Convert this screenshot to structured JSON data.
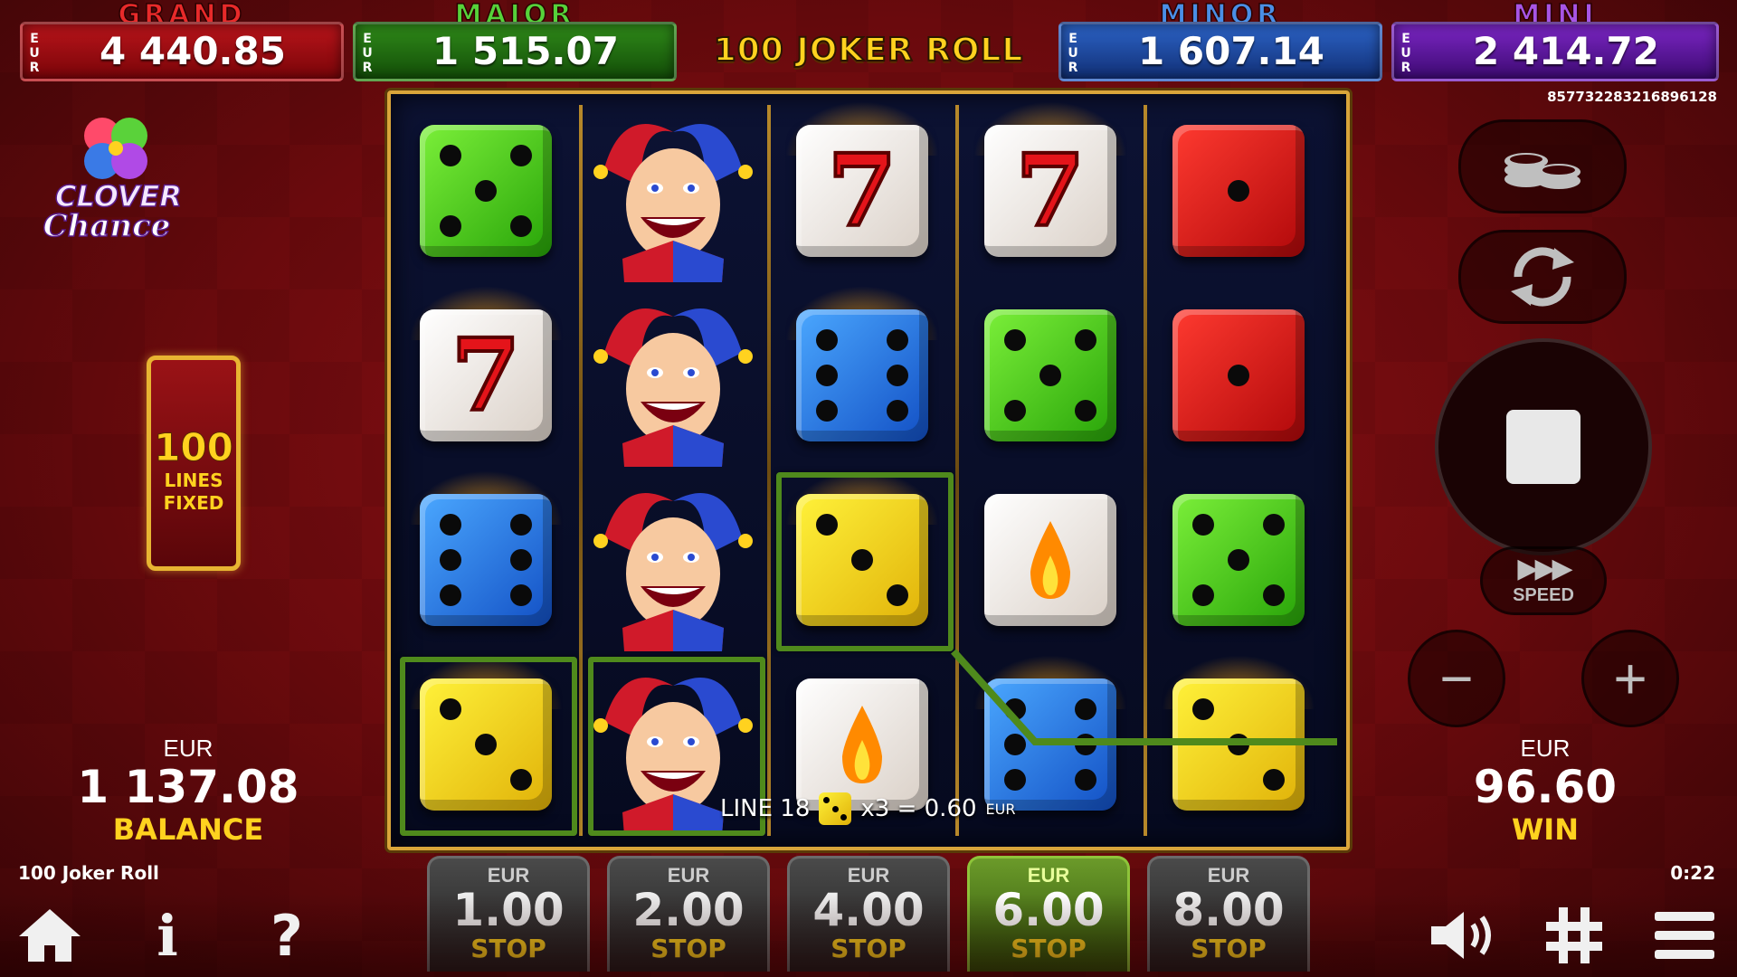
{
  "jackpots": {
    "grand": {
      "title": "GRAND",
      "currency": "EUR",
      "value": "4 440.85",
      "color": "#e82a2a"
    },
    "major": {
      "title": "MAJOR",
      "currency": "EUR",
      "value": "1 515.07",
      "color": "#56d23a"
    },
    "minor": {
      "title": "MINOR",
      "currency": "EUR",
      "value": "1 607.14",
      "color": "#4a8fe6"
    },
    "mini": {
      "title": "MINI",
      "currency": "EUR",
      "value": "2 414.72",
      "color": "#a755e6"
    }
  },
  "game_title": "100 JOKER ROLL",
  "round_id": "857732283216896128",
  "logo": {
    "line1": "CLOVER",
    "line2": "Chance"
  },
  "lines": {
    "count": "100",
    "label1": "LINES",
    "label2": "FIXED"
  },
  "balance": {
    "currency": "EUR",
    "value": "1 137.08",
    "label": "BALANCE"
  },
  "win": {
    "currency": "EUR",
    "value": "96.60",
    "label": "WIN"
  },
  "footer": {
    "game_name": "100 Joker Roll",
    "clock": "0:22"
  },
  "line_win": {
    "line": "LINE 18",
    "multiplier": "x3 = 0.60",
    "currency": "EUR",
    "symbol": "yellow-die-icon"
  },
  "reels": [
    [
      "green-die-5",
      "seven-die",
      "blue-die-6",
      "yellow-die-3"
    ],
    [
      "joker",
      "joker",
      "joker",
      "joker"
    ],
    [
      "seven-die",
      "blue-die-6",
      "yellow-die-3",
      "flame-die"
    ],
    [
      "seven-die",
      "green-die-5",
      "flame-die",
      "blue-die-6"
    ],
    [
      "red-die-1",
      "red-die-1",
      "green-die-5",
      "yellow-die-3"
    ]
  ],
  "highlighted_cells": [
    [
      0,
      3
    ],
    [
      1,
      3
    ],
    [
      2,
      2
    ]
  ],
  "bets": [
    {
      "currency": "EUR",
      "value": "1.00",
      "label": "STOP",
      "active": false
    },
    {
      "currency": "EUR",
      "value": "2.00",
      "label": "STOP",
      "active": false
    },
    {
      "currency": "EUR",
      "value": "4.00",
      "label": "STOP",
      "active": false
    },
    {
      "currency": "EUR",
      "value": "6.00",
      "label": "STOP",
      "active": true
    },
    {
      "currency": "EUR",
      "value": "8.00",
      "label": "STOP",
      "active": false
    }
  ],
  "controls": {
    "coins": "coins-icon",
    "autoplay": "autoplay-icon",
    "spin": "stop-icon",
    "speed_label": "SPEED",
    "minus": "−",
    "plus": "+"
  },
  "bottom_icons": {
    "home": "home-icon",
    "info": "i",
    "help": "?",
    "sound": "speaker-icon",
    "table": "grid-icon",
    "menu": "menu-icon"
  },
  "colors": {
    "accent_gold": "#ffd21f",
    "payline_green": "#4f8a1c",
    "background_red": "#6b0a0c"
  }
}
